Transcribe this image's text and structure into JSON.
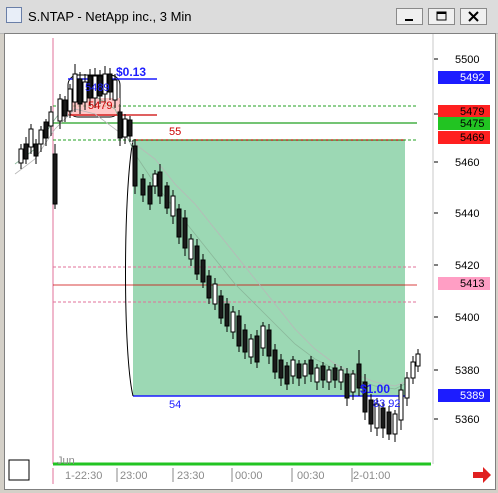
{
  "window": {
    "title": "S.NTAP - NetApp inc., 3 Min",
    "icons": [
      "app-icon",
      "minimize-icon",
      "maximize-icon",
      "close-icon"
    ]
  },
  "chart": {
    "y_ticks": [
      "5500",
      "5480",
      "5460",
      "5440",
      "5420",
      "5400",
      "5380",
      "5360"
    ],
    "x_ticks": [
      "Jun",
      "1-22:30",
      "23:00",
      "23:30",
      "00:00",
      "00:30",
      "2-01:00"
    ],
    "price_tags": [
      {
        "label": "5492",
        "color": "#1c1cff",
        "text_color": "#ffffff"
      },
      {
        "label": "5479",
        "color": "#ff2020",
        "text_color": "#000000"
      },
      {
        "label": "5475",
        "color": "#22c422",
        "text_color": "#000000"
      },
      {
        "label": "5469",
        "color": "#ff2020",
        "text_color": "#000000"
      },
      {
        "label": "5413",
        "color": "#ff9ec4",
        "text_color": "#000000"
      },
      {
        "label": "5389",
        "color": "#1c1cff",
        "text_color": "#ffffff"
      }
    ],
    "annotations": {
      "top_box_profit": "$0.13",
      "top_box_price_a": "5489",
      "top_box_price_b": "5479",
      "entry_label": "55",
      "exit_label": "54",
      "bottom_profit": "$1.00",
      "bottom_price": "83 92"
    },
    "colors": {
      "trade_zone": "#9cd8b4",
      "up_candle": "#ffffff",
      "down_candle": "#1a1a1a",
      "blue_line": "#1c1cff",
      "red_line": "#cc0000",
      "green_line": "#22a022",
      "pink_line": "#e0709a"
    },
    "scroll_arrow_icon": "right-arrow-icon"
  }
}
